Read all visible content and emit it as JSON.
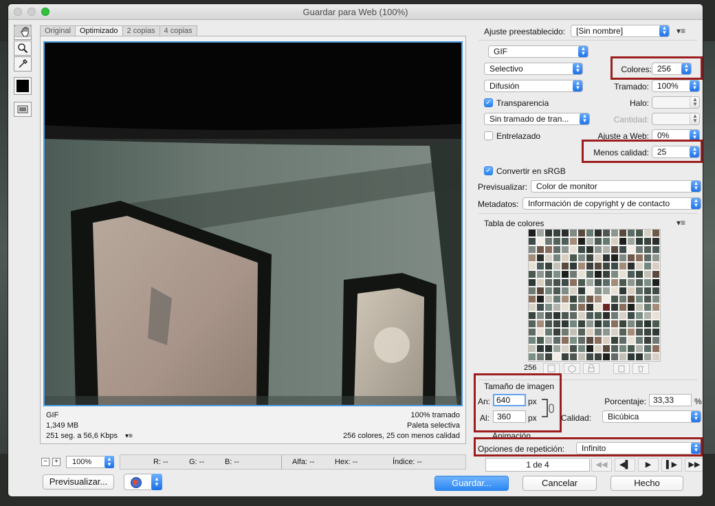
{
  "window": {
    "title": "Guardar para Web (100%)"
  },
  "tabs": [
    "Original",
    "Optimizado",
    "2 copias",
    "4 copias"
  ],
  "preview_info": {
    "left": [
      "GIF",
      "1,349 MB",
      "251 seg. a 56,6 Kbps"
    ],
    "right": [
      "100% tramado",
      "Paleta selectiva",
      "256 colores, 25 con menos calidad"
    ]
  },
  "statusbar": {
    "zoom": "100%",
    "r": "R: --",
    "g": "G: --",
    "b": "B: --",
    "alpha": "Alfa: --",
    "hex": "Hex: --",
    "index": "Índice: --"
  },
  "buttons": {
    "preview": "Previsualizar...",
    "save": "Guardar...",
    "cancel": "Cancelar",
    "done": "Hecho"
  },
  "settings": {
    "preset_label": "Ajuste preestablecido:",
    "preset_value": "[Sin nombre]",
    "format": "GIF",
    "reduction": "Selectivo",
    "dither_algo": "Difusión",
    "colors_label": "Colores:",
    "colors_value": "256",
    "dither_label": "Tramado:",
    "dither_value": "100%",
    "transparency_label": "Transparencia",
    "matte_label": "Halo:",
    "matte_value": "",
    "transp_dither": "Sin tramado de tran...",
    "amount_label": "Cantidad:",
    "amount_value": "",
    "interlaced_label": "Entrelazado",
    "websnap_label": "Ajuste a Web:",
    "websnap_value": "0%",
    "lossy_label": "Menos calidad:",
    "lossy_value": "25",
    "srgb_label": "Convertir en sRGB",
    "preview_label": "Previsualizar:",
    "preview_value": "Color de monitor",
    "metadata_label": "Metadatos:",
    "metadata_value": "Información de copyright y de contacto"
  },
  "color_table": {
    "title": "Tabla de colores",
    "count": "256",
    "palette": [
      "#1d1f1c",
      "#2b2e2a",
      "#3a3f3b",
      "#4f5752",
      "#606b65",
      "#6f7a73",
      "#7f8a83",
      "#8e978f",
      "#9ea59d",
      "#b1b4ac",
      "#c3c0b5",
      "#d6d1c4",
      "#e6e1d3",
      "#5a4a3d",
      "#6e5a4a",
      "#3c463f",
      "#46524b",
      "#55625a",
      "#2f3a37",
      "#3e4b48",
      "#4c5c58",
      "#5b6c67",
      "#667a72",
      "#74877f",
      "#8a6f5c",
      "#a58c78",
      "#d9cfc0",
      "#f2eee5",
      "#2a3430",
      "#7b8f86",
      "#39443c",
      "#4a5a4f"
    ],
    "highlight_index": 153
  },
  "image_size": {
    "title": "Tamaño de imagen",
    "width_label": "An:",
    "width_value": "640",
    "height_label": "Al:",
    "height_value": "360",
    "unit": "px",
    "percent_label": "Porcentaje:",
    "percent_value": "33,33",
    "percent_unit": "%",
    "quality_label": "Calidad:",
    "quality_value": "Bicúbica"
  },
  "animation": {
    "title": "Animación",
    "loop_label": "Opciones de repetición:",
    "loop_value": "Infinito",
    "frame": "1 de 4"
  },
  "colors": {
    "accent": "#2a86f3",
    "highlight_box": "#9b1d1d"
  }
}
